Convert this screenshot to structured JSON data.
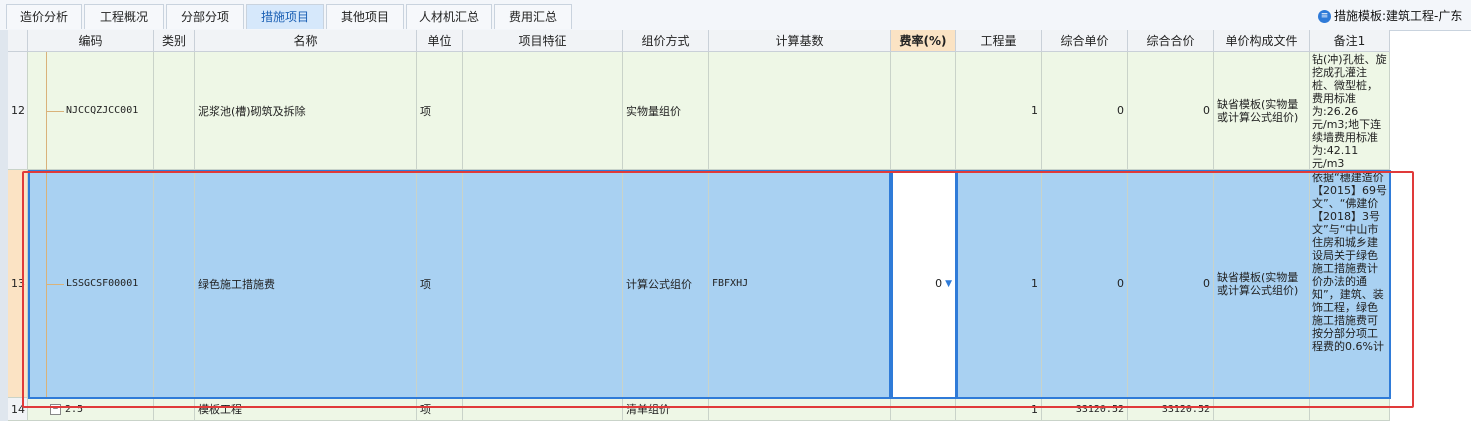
{
  "tabs": [
    {
      "label": "造价分析"
    },
    {
      "label": "工程概况"
    },
    {
      "label": "分部分项"
    },
    {
      "label": "措施项目",
      "active": true
    },
    {
      "label": "其他项目"
    },
    {
      "label": "人材机汇总"
    },
    {
      "label": "费用汇总"
    }
  ],
  "template_label": "措施模板:建筑工程-广东",
  "columns": {
    "code": "编码",
    "type": "类别",
    "name": "名称",
    "unit": "单位",
    "feature": "项目特征",
    "method": "组价方式",
    "base": "计算基数",
    "rate": "费率(%)",
    "qty": "工程量",
    "uprice": "综合单价",
    "total": "综合合价",
    "file": "单价构成文件",
    "note": "备注1"
  },
  "rows": [
    {
      "no": "12",
      "code": "NJCCQZJCC001",
      "type": "",
      "name": "泥浆池(槽)砌筑及拆除",
      "unit": "项",
      "feature": "",
      "method": "实物量组价",
      "base": "",
      "rate": "",
      "qty": "1",
      "uprice": "0",
      "total": "0",
      "file": "缺省模板(实物量或计算公式组价)",
      "note": "钻(冲)孔桩、旋挖成孔灌注桩、微型桩，费用标准为:26.26元/m3;地下连续墙费用标准为:42.11元/m3"
    },
    {
      "no": "13",
      "code": "LSSGCSF00001",
      "type": "",
      "name": "绿色施工措施费",
      "unit": "项",
      "feature": "",
      "method": "计算公式组价",
      "base": "FBFXHJ",
      "rate": "0",
      "qty": "1",
      "uprice": "0",
      "total": "0",
      "file": "缺省模板(实物量或计算公式组价)",
      "note": "依据“穗建造价【2015】69号文”、“佛建价【2018】3号文”与“中山市住房和城乡建设局关于绿色施工措施费计价办法的通知”，建筑、装饰工程，绿色施工措施费可按分部分项工程费的0.6%计"
    },
    {
      "no": "14",
      "code": "2.5",
      "type": "",
      "name": "模板工程",
      "unit": "项",
      "feature": "",
      "method": "清单组价",
      "base": "",
      "rate": "",
      "qty": "1",
      "uprice": "33120.52",
      "total": "33120.52",
      "file": "",
      "note": ""
    }
  ]
}
